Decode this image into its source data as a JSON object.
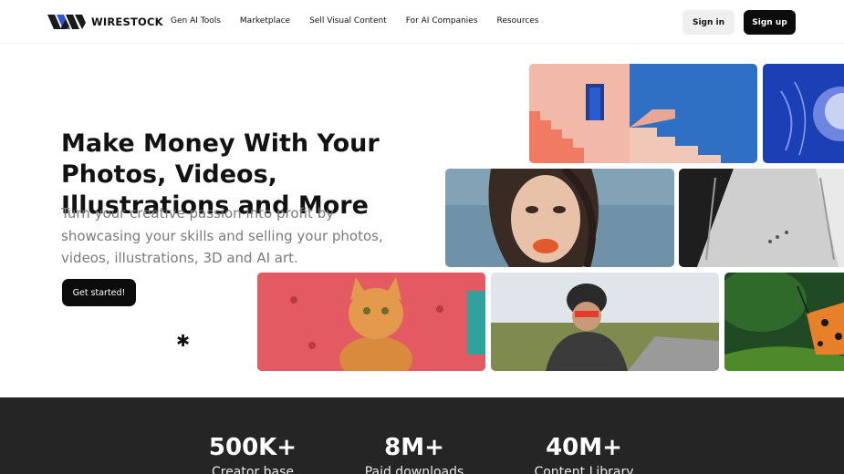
{
  "header": {
    "brand": "WIRESTOCK",
    "nav": [
      "Gen AI Tools",
      "Marketplace",
      "Sell Visual Content",
      "For AI Companies",
      "Resources"
    ],
    "sign_in": "Sign in",
    "sign_up": "Sign up"
  },
  "hero": {
    "title": "Make Money With Your Photos, Videos, Illustrations and More",
    "subtitle": "Turn your creative passion into profit by showcasing your skills and selling your photos, videos, illustrations, 3D and AI art.",
    "cta": "Get started!",
    "decor_glyph": "✱"
  },
  "gallery": [
    {
      "name": "pink-stairs-image",
      "subject": "pink staircase"
    },
    {
      "name": "jellyfish-image",
      "subject": "jellyfish"
    },
    {
      "name": "woman-portrait-image",
      "subject": "woman portrait"
    },
    {
      "name": "corridor-image",
      "subject": "aerial corridor"
    },
    {
      "name": "cat-image",
      "subject": "cat on red sofa"
    },
    {
      "name": "cyclist-image",
      "subject": "cyclist"
    },
    {
      "name": "butterfly-image",
      "subject": "butterfly"
    }
  ],
  "stats": [
    {
      "value": "500K+",
      "label": "Creator base"
    },
    {
      "value": "8M+",
      "label": "Paid downloads"
    },
    {
      "value": "40M+",
      "label": "Content Library"
    }
  ],
  "colors": {
    "dark": "#0c0c0c",
    "stats_bg": "#252525",
    "muted_text": "#7a7a7a"
  }
}
